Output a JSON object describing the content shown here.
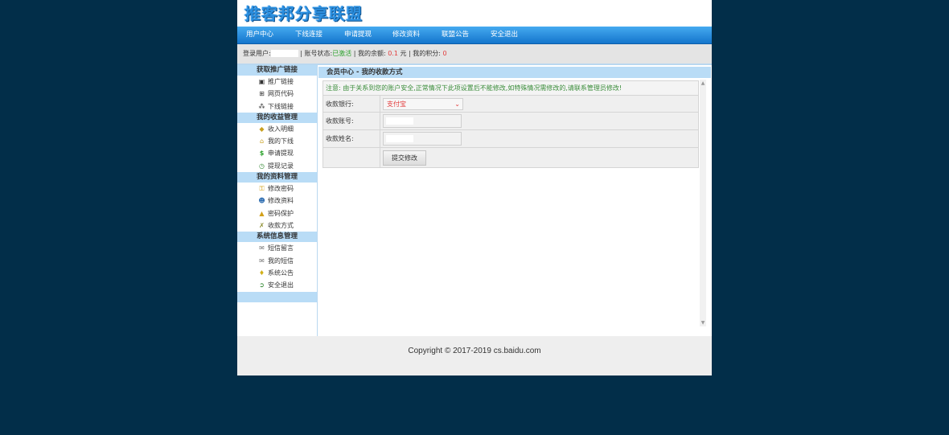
{
  "logo": "推客邦分享联盟",
  "nav": [
    {
      "label": "用户中心"
    },
    {
      "label": "下线连接"
    },
    {
      "label": "申请提现"
    },
    {
      "label": "修改资料"
    },
    {
      "label": "联盟公告"
    },
    {
      "label": "安全退出"
    }
  ],
  "status": {
    "user_label": "登录用户:",
    "account_state_label": "| 账号状态:",
    "account_state": "已激活",
    "balance_label": "| 我的余额:",
    "balance": "0.1",
    "balance_unit": "元",
    "points_label": "| 我的积分:",
    "points": "0"
  },
  "sidebar": {
    "sections": [
      {
        "title": "获取推广链接",
        "items": [
          {
            "label": "推广链接",
            "icon": "link-icon"
          },
          {
            "label": "网页代码",
            "icon": "code-icon"
          },
          {
            "label": "下线链接",
            "icon": "network-icon"
          }
        ]
      },
      {
        "title": "我的收益管理",
        "items": [
          {
            "label": "收入明细",
            "icon": "coins-icon"
          },
          {
            "label": "我的下线",
            "icon": "house-icon"
          },
          {
            "label": "申请提现",
            "icon": "dollar-icon"
          },
          {
            "label": "提现记录",
            "icon": "clock-icon"
          }
        ]
      },
      {
        "title": "我的资料管理",
        "items": [
          {
            "label": "修改密码",
            "icon": "key-icon"
          },
          {
            "label": "修改资料",
            "icon": "users-icon"
          },
          {
            "label": "密码保护",
            "icon": "lock-icon"
          },
          {
            "label": "收款方式",
            "icon": "wrench-icon"
          }
        ]
      },
      {
        "title": "系统信息管理",
        "items": [
          {
            "label": "短信留言",
            "icon": "mail-icon"
          },
          {
            "label": "我的短信",
            "icon": "mail-icon"
          },
          {
            "label": "系统公告",
            "icon": "bulb-icon"
          },
          {
            "label": "安全退出",
            "icon": "exit-icon"
          }
        ]
      }
    ]
  },
  "main": {
    "title": "会员中心 - 我的收款方式",
    "notice": "注意: 由于关系到您的账户安全,正常情况下此项设置后不能修改,如特殊情况需修改的,请联系管理员修改!",
    "bank_label": "收款银行:",
    "bank_value": "支付宝",
    "account_label": "收款账号:",
    "name_label": "收款姓名:",
    "submit_label": "提交修改"
  },
  "footer": "Copyright © 2017-2019 cs.baidu.com",
  "colors": {
    "background": "#022e49",
    "nav": "#1f86dc",
    "section": "#b9dcf6",
    "accent_green": "#2aa12a",
    "accent_red": "#e23b3b"
  }
}
